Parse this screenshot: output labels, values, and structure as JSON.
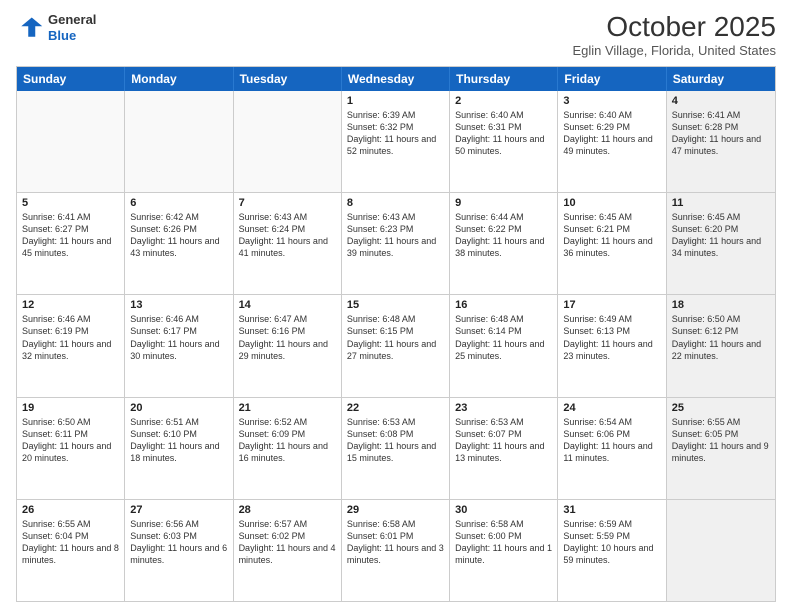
{
  "header": {
    "logo": {
      "general": "General",
      "blue": "Blue"
    },
    "title": "October 2025",
    "location": "Eglin Village, Florida, United States"
  },
  "days_of_week": [
    "Sunday",
    "Monday",
    "Tuesday",
    "Wednesday",
    "Thursday",
    "Friday",
    "Saturday"
  ],
  "rows": [
    [
      {
        "day": "",
        "empty": true
      },
      {
        "day": "",
        "empty": true
      },
      {
        "day": "",
        "empty": true
      },
      {
        "day": "1",
        "sunrise": "6:39 AM",
        "sunset": "6:32 PM",
        "daylight": "11 hours and 52 minutes."
      },
      {
        "day": "2",
        "sunrise": "6:40 AM",
        "sunset": "6:31 PM",
        "daylight": "11 hours and 50 minutes."
      },
      {
        "day": "3",
        "sunrise": "6:40 AM",
        "sunset": "6:29 PM",
        "daylight": "11 hours and 49 minutes."
      },
      {
        "day": "4",
        "sunrise": "6:41 AM",
        "sunset": "6:28 PM",
        "daylight": "11 hours and 47 minutes.",
        "shaded": true
      }
    ],
    [
      {
        "day": "5",
        "sunrise": "6:41 AM",
        "sunset": "6:27 PM",
        "daylight": "11 hours and 45 minutes."
      },
      {
        "day": "6",
        "sunrise": "6:42 AM",
        "sunset": "6:26 PM",
        "daylight": "11 hours and 43 minutes."
      },
      {
        "day": "7",
        "sunrise": "6:43 AM",
        "sunset": "6:24 PM",
        "daylight": "11 hours and 41 minutes."
      },
      {
        "day": "8",
        "sunrise": "6:43 AM",
        "sunset": "6:23 PM",
        "daylight": "11 hours and 39 minutes."
      },
      {
        "day": "9",
        "sunrise": "6:44 AM",
        "sunset": "6:22 PM",
        "daylight": "11 hours and 38 minutes."
      },
      {
        "day": "10",
        "sunrise": "6:45 AM",
        "sunset": "6:21 PM",
        "daylight": "11 hours and 36 minutes."
      },
      {
        "day": "11",
        "sunrise": "6:45 AM",
        "sunset": "6:20 PM",
        "daylight": "11 hours and 34 minutes.",
        "shaded": true
      }
    ],
    [
      {
        "day": "12",
        "sunrise": "6:46 AM",
        "sunset": "6:19 PM",
        "daylight": "11 hours and 32 minutes."
      },
      {
        "day": "13",
        "sunrise": "6:46 AM",
        "sunset": "6:17 PM",
        "daylight": "11 hours and 30 minutes."
      },
      {
        "day": "14",
        "sunrise": "6:47 AM",
        "sunset": "6:16 PM",
        "daylight": "11 hours and 29 minutes."
      },
      {
        "day": "15",
        "sunrise": "6:48 AM",
        "sunset": "6:15 PM",
        "daylight": "11 hours and 27 minutes."
      },
      {
        "day": "16",
        "sunrise": "6:48 AM",
        "sunset": "6:14 PM",
        "daylight": "11 hours and 25 minutes."
      },
      {
        "day": "17",
        "sunrise": "6:49 AM",
        "sunset": "6:13 PM",
        "daylight": "11 hours and 23 minutes."
      },
      {
        "day": "18",
        "sunrise": "6:50 AM",
        "sunset": "6:12 PM",
        "daylight": "11 hours and 22 minutes.",
        "shaded": true
      }
    ],
    [
      {
        "day": "19",
        "sunrise": "6:50 AM",
        "sunset": "6:11 PM",
        "daylight": "11 hours and 20 minutes."
      },
      {
        "day": "20",
        "sunrise": "6:51 AM",
        "sunset": "6:10 PM",
        "daylight": "11 hours and 18 minutes."
      },
      {
        "day": "21",
        "sunrise": "6:52 AM",
        "sunset": "6:09 PM",
        "daylight": "11 hours and 16 minutes."
      },
      {
        "day": "22",
        "sunrise": "6:53 AM",
        "sunset": "6:08 PM",
        "daylight": "11 hours and 15 minutes."
      },
      {
        "day": "23",
        "sunrise": "6:53 AM",
        "sunset": "6:07 PM",
        "daylight": "11 hours and 13 minutes."
      },
      {
        "day": "24",
        "sunrise": "6:54 AM",
        "sunset": "6:06 PM",
        "daylight": "11 hours and 11 minutes."
      },
      {
        "day": "25",
        "sunrise": "6:55 AM",
        "sunset": "6:05 PM",
        "daylight": "11 hours and 9 minutes.",
        "shaded": true
      }
    ],
    [
      {
        "day": "26",
        "sunrise": "6:55 AM",
        "sunset": "6:04 PM",
        "daylight": "11 hours and 8 minutes."
      },
      {
        "day": "27",
        "sunrise": "6:56 AM",
        "sunset": "6:03 PM",
        "daylight": "11 hours and 6 minutes."
      },
      {
        "day": "28",
        "sunrise": "6:57 AM",
        "sunset": "6:02 PM",
        "daylight": "11 hours and 4 minutes."
      },
      {
        "day": "29",
        "sunrise": "6:58 AM",
        "sunset": "6:01 PM",
        "daylight": "11 hours and 3 minutes."
      },
      {
        "day": "30",
        "sunrise": "6:58 AM",
        "sunset": "6:00 PM",
        "daylight": "11 hours and 1 minute."
      },
      {
        "day": "31",
        "sunrise": "6:59 AM",
        "sunset": "5:59 PM",
        "daylight": "10 hours and 59 minutes."
      },
      {
        "day": "",
        "empty": true,
        "shaded": true
      }
    ]
  ]
}
